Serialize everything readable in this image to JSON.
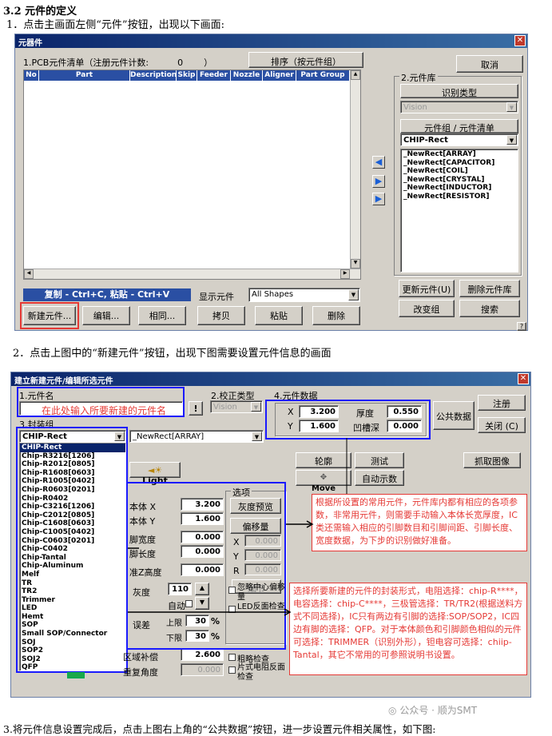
{
  "doc": {
    "heading": "3.2 元件的定义",
    "step1": "1．点击主画面左侧“元件”按钮，出现以下画面:",
    "step2": "2．点击上图中的“新建元件”按钮，出现下图需要设置元件信息的画面",
    "step3": "3.将元件信息设置完成后，点击上图右上角的“公共数据”按钮，进一步设置元件相关属性，如下图:",
    "watermark": "公众号 · 顺为SMT"
  },
  "win1": {
    "title": "元器件",
    "list_title": "1.PCB元件清单（注册元件计数:",
    "count": "0",
    "paren": "）",
    "sort_button": "排序（按元件组）",
    "cancel_button": "取消",
    "columns": [
      "No",
      "Part",
      "Description",
      "Skip",
      "Feeder",
      "Nozzle",
      "Aligner",
      "Part Group"
    ],
    "copy_bar": "复制 - Ctrl+C, 粘贴 - Ctrl+V",
    "display_label": "显示元件",
    "display_value": "All Shapes",
    "buttons": {
      "new": "新建元件...",
      "edit": "编辑...",
      "same": "相同...",
      "copy": "拷贝",
      "paste": "粘贴",
      "delete": "删除"
    },
    "lib_title": "2.元件库",
    "recog_label": "识别类型",
    "recog_value": "Vision",
    "group_label": "元件组 / 元件清单",
    "group_value": "CHIP-Rect",
    "lib_items": [
      "_NewRect[ARRAY]",
      "_NewRect[CAPACITOR]",
      "_NewRect[COIL]",
      "_NewRect[CRYSTAL]",
      "_NewRect[INDUCTOR]",
      "_NewRect[RESISTOR]"
    ],
    "update_button": "更新元件(U)",
    "delete_comp_button": "删除元件库",
    "change_group_button": "改变组",
    "search_button": "搜索",
    "help": "?"
  },
  "win2": {
    "title": "建立新建元件/编辑所选元件",
    "name_label": "1.元件名",
    "name_hint": "在此处输入所要新建的元件名",
    "bang": "!",
    "align_label": "2.校正类型",
    "align_value": "Vision",
    "data_label": "4.元件数据",
    "x_label": "X",
    "x_value": "3.200",
    "y_label": "Y",
    "y_value": "1.600",
    "thick_label": "厚度",
    "thick_value": "0.550",
    "groove_label": "凹槽深",
    "groove_value": "0.000",
    "common_button": "公共数据",
    "register_button": "注册",
    "close_button": "关闭 (C)",
    "pkg_label": "3.封装组",
    "pkg_value": "CHIP-Rect",
    "pkg2_value": "_NewRect[ARRAY]",
    "pkg_list": [
      "CHIP-Rect",
      "Chip-R3216[1206]",
      "Chip-R2012[0805]",
      "Chip-R1608[0603]",
      "Chip-R1005[0402]",
      "Chip-R0603[0201]",
      "Chip-R0402",
      "Chip-C3216[1206]",
      "Chip-C2012[0805]",
      "Chip-C1608[0603]",
      "Chip-C1005[0402]",
      "Chip-C0603[0201]",
      "Chip-C0402",
      "Chip-Tantal",
      "Chip-Aluminum",
      "Melf",
      "TR",
      "TR2",
      "Trimmer",
      "LED",
      "Hemt",
      "SOP",
      "Small SOP/Connector",
      "SOJ",
      "SOP2",
      "SOJ2",
      "QFP"
    ],
    "light_button": "Light",
    "outline_button": "轮廓",
    "test_button": "测试",
    "grab_button": "抓取图像",
    "move_button": "Move",
    "auto_show_button": "自动示数",
    "options_label": "选项",
    "body_x_label": "本体 X",
    "body_x_value": "3.200",
    "body_y_label": "本体 Y",
    "body_y_value": "1.600",
    "lead_w_label": "脚宽度",
    "lead_w_value": "0.000",
    "lead_l_label": "脚长度",
    "lead_l_value": "0.000",
    "z_label": "准Z高度",
    "z_value": "0.000",
    "gray_label": "灰度",
    "gray_value": "110",
    "auto_label": "自动",
    "err_label": "误差",
    "upper_label": "上限",
    "upper_value": "30",
    "lower_label": "下限",
    "lower_value": "30",
    "pct": "%",
    "comp_label": "区域补偿",
    "comp_value": "2.600",
    "angle_label": "重复角度",
    "angle_value": "0.000",
    "gray_preview_button": "灰度预览",
    "offset_button": "偏移量",
    "ox": "X",
    "oy": "Y",
    "or": "R",
    "o_value": "0.000",
    "detail_button": "细节",
    "ignore_check": "忽略中心偏移量",
    "led_check": "LED反面检查",
    "coarse_check": "粗略检查",
    "chip_check": "片式电阻反面检查"
  },
  "notes": {
    "data_note": "根据所设置的常用元件，元件库内都有相应的各项参数，非常用元件，则需要手动输入本体长宽厚度，IC类还需输入相应的引脚数目和引脚间距、引脚长度、宽度数据，为下步的识别做好准备。",
    "pkg_note": "选择所要新建的元件的封装形式，电阻选择：chip-R****，电容选择：chip-C****，三极管选择：TR/TR2(根据送料方式不同选择)，IC只有两边有引脚的选择:SOP/SOP2，IC四边有脚的选择：QFP。对于本体颜色和引脚颜色相似的元件可选择：TRIMMER（识别外形），钽电容可选择：chiip-Tantal，其它不常用的可参照说明书设置。"
  },
  "colors": {
    "title_bar": "#0a246a",
    "highlight": "#e53935",
    "callout": "#1a1aff",
    "copy_bar": "#2a4fa3"
  }
}
